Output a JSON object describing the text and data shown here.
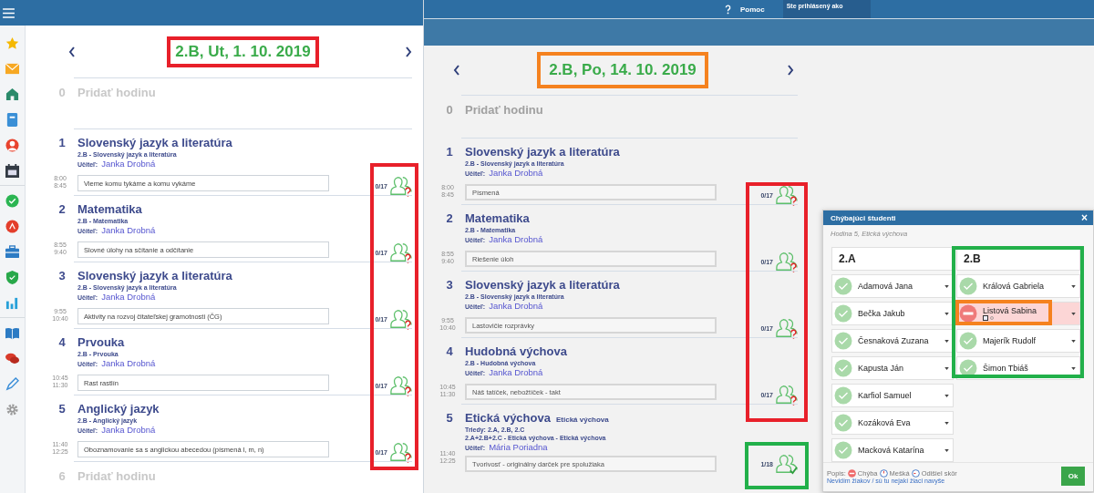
{
  "left_view": {
    "title": "2.B, Ut, 1. 10. 2019",
    "lessons": [
      {
        "kind": "add",
        "number": "0",
        "label": "Pridať hodinu"
      },
      {
        "kind": "lesson",
        "number": "1",
        "subject": "Slovenský jazyk a literatúra",
        "group": "2.B - Slovenský jazyk a literatúra",
        "teacher_label": "Učiteľ:",
        "teacher": "Janka Drobná",
        "start": "8:00",
        "end": "8:45",
        "topic": "Vieme komu tykáme a komu vykáme",
        "attendance": "0/17",
        "confirmed": false
      },
      {
        "kind": "lesson",
        "number": "2",
        "subject": "Matematika",
        "group": "2.B - Matematika",
        "teacher_label": "Učiteľ:",
        "teacher": "Janka Drobná",
        "start": "8:55",
        "end": "9:40",
        "topic": "Slovné úlohy na sčítanie a odčítanie",
        "attendance": "0/17",
        "confirmed": false
      },
      {
        "kind": "lesson",
        "number": "3",
        "subject": "Slovenský jazyk a literatúra",
        "group": "2.B - Slovenský jazyk a literatúra",
        "teacher_label": "Učiteľ:",
        "teacher": "Janka Drobná",
        "start": "9:55",
        "end": "10:40",
        "topic": "Aktivity na rozvoj čitateľskej gramotnosti (ČG)",
        "attendance": "0/17",
        "confirmed": false
      },
      {
        "kind": "lesson",
        "number": "4",
        "subject": "Prvouka",
        "group": "2.B - Prvouka",
        "teacher_label": "Učiteľ:",
        "teacher": "Janka Drobná",
        "start": "10:45",
        "end": "11:30",
        "topic": "Rast rastlín",
        "attendance": "0/17",
        "confirmed": false
      },
      {
        "kind": "lesson",
        "number": "5",
        "subject": "Anglický jazyk",
        "group": "2.B - Anglický jazyk",
        "teacher_label": "Učiteľ:",
        "teacher": "Janka Drobná",
        "start": "11:40",
        "end": "12:25",
        "topic": "Oboznamovanie sa s anglickou abecedou (písmená l, m, n)",
        "attendance": "0/17",
        "confirmed": false
      },
      {
        "kind": "add",
        "number": "6",
        "label": "Pridať hodinu"
      }
    ]
  },
  "right_view": {
    "help": "Pomoc",
    "user_label": "Ste prihlásený ako",
    "title": "2.B, Po, 14. 10. 2019",
    "lessons": [
      {
        "kind": "add",
        "number": "0",
        "label": "Pridať hodinu"
      },
      {
        "kind": "lesson",
        "number": "1",
        "subject": "Slovenský jazyk a literatúra",
        "group": "2.B - Slovenský jazyk a literatúra",
        "teacher_label": "Učiteľ:",
        "teacher": "Janka Drobná",
        "start": "8:00",
        "end": "8:45",
        "topic": "Písmená",
        "attendance": "0/17",
        "confirmed": false
      },
      {
        "kind": "lesson",
        "number": "2",
        "subject": "Matematika",
        "group": "2.B - Matematika",
        "teacher_label": "Učiteľ:",
        "teacher": "Janka Drobná",
        "start": "8:55",
        "end": "9:40",
        "topic": "Riešenie úloh",
        "attendance": "0/17",
        "confirmed": false
      },
      {
        "kind": "lesson",
        "number": "3",
        "subject": "Slovenský jazyk a literatúra",
        "group": "2.B - Slovenský jazyk a literatúra",
        "teacher_label": "Učiteľ:",
        "teacher": "Janka Drobná",
        "start": "9:55",
        "end": "10:40",
        "topic": "Lastovičie rozprávky",
        "attendance": "0/17",
        "confirmed": false
      },
      {
        "kind": "lesson",
        "number": "4",
        "subject": "Hudobná výchova",
        "group": "2.B - Hudobná výchova",
        "teacher_label": "Učiteľ:",
        "teacher": "Janka Drobná",
        "start": "10:45",
        "end": "11:30",
        "topic": "Náš tatíček, nebožtíček - takt",
        "attendance": "0/17",
        "confirmed": false
      },
      {
        "kind": "lesson",
        "number": "5",
        "subject": "Etická výchova",
        "subject_note": "Etická výchova",
        "classes_label": "Triedy:",
        "classes": "2.A, 2.B, 2.C",
        "group": "2.A+2.B+2.C - Etická výchova - Etická výchova",
        "teacher_label": "Učiteľ:",
        "teacher": "Mária Poriadna",
        "start": "11:40",
        "end": "12:25",
        "topic": "Tvorivosť - originálny darček pre spolužiaka",
        "attendance": "1/18",
        "confirmed": true
      }
    ]
  },
  "dialog": {
    "title": "Chýbajúci študenti",
    "close": "×",
    "subtitle": "Hodina 5, Etická výchova",
    "classes": [
      {
        "name": "2.A",
        "students": [
          {
            "name": "Adamová Jana",
            "absent": false
          },
          {
            "name": "Bečka Jakub",
            "absent": false
          },
          {
            "name": "Česnaková Zuzana",
            "absent": false
          },
          {
            "name": "Kapusta Ján",
            "absent": false
          },
          {
            "name": "Karfiol Samuel",
            "absent": false
          },
          {
            "name": "Kozáková Eva",
            "absent": false
          },
          {
            "name": "Macková Katarína",
            "absent": false
          }
        ]
      },
      {
        "name": "2.B",
        "students": [
          {
            "name": "Králová Gabriela",
            "absent": false
          },
          {
            "name": "Listová Sabina",
            "absent": true
          },
          {
            "name": "Majerík Rudolf",
            "absent": false
          },
          {
            "name": "Šimon Tbiáš",
            "absent": false
          }
        ]
      }
    ],
    "legend_label": "Popis:",
    "legend": [
      {
        "kind": "absent",
        "label": "Chýba"
      },
      {
        "kind": "late",
        "label": "Mešká"
      },
      {
        "kind": "left",
        "label": "Odišiel skôr"
      }
    ],
    "link": "Nevidím žiakov / sú tu nejakí žiaci navyše",
    "ok": "Ok"
  },
  "annotations": [
    {
      "color": "#e8202a"
    },
    {
      "color": "#e8202a"
    },
    {
      "color": "#f5821f"
    },
    {
      "color": "#e8202a"
    },
    {
      "color": "#22b04a"
    },
    {
      "color": "#22b04a"
    },
    {
      "color": "#f5821f"
    }
  ]
}
